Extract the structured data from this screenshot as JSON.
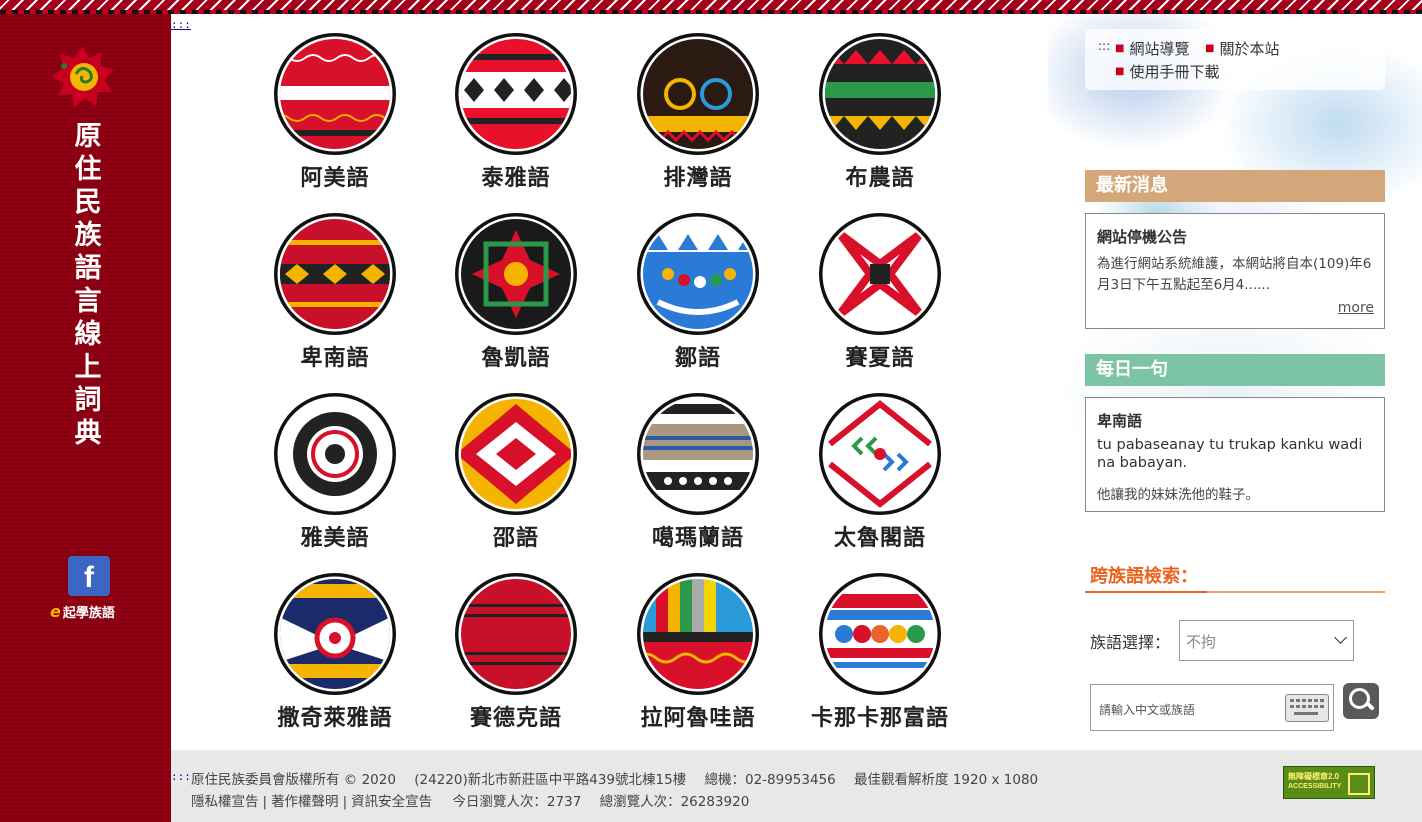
{
  "accesskey": ":::",
  "sidebar": {
    "title": "原住民族語言線上詞典",
    "facebook_icon": "facebook-icon",
    "facebook_glyph": "f",
    "elearning_mark": "e",
    "elearning_label": "起學族語"
  },
  "languages": [
    {
      "label": "阿美語",
      "pattern": "amis"
    },
    {
      "label": "泰雅語",
      "pattern": "atayal"
    },
    {
      "label": "排灣語",
      "pattern": "paiwan"
    },
    {
      "label": "布農語",
      "pattern": "bunun"
    },
    {
      "label": "卑南語",
      "pattern": "puyuma"
    },
    {
      "label": "魯凱語",
      "pattern": "rukai"
    },
    {
      "label": "鄒語",
      "pattern": "tsou"
    },
    {
      "label": "賽夏語",
      "pattern": "saisiyat"
    },
    {
      "label": "雅美語",
      "pattern": "yami"
    },
    {
      "label": "邵語",
      "pattern": "thao"
    },
    {
      "label": "噶瑪蘭語",
      "pattern": "kavalan"
    },
    {
      "label": "太魯閣語",
      "pattern": "truku"
    },
    {
      "label": "撒奇萊雅語",
      "pattern": "sakizaya"
    },
    {
      "label": "賽德克語",
      "pattern": "seediq"
    },
    {
      "label": "拉阿魯哇語",
      "pattern": "hlaalua"
    },
    {
      "label": "卡那卡那富語",
      "pattern": "kanakanavu"
    }
  ],
  "quicklinks": {
    "prefix": ":::",
    "sitemap": "網站導覽",
    "about": "關於本站",
    "manual": "使用手冊下載"
  },
  "news": {
    "heading": "最新消息",
    "heading_color": "#d4a77b",
    "title": "網站停機公告",
    "body": "為進行網站系統維護，本網站將自本(109)年6月3日下午五點起至6月4......",
    "more": "more"
  },
  "daily": {
    "heading": "每日一句",
    "heading_color": "#7dc3a5",
    "language": "卑南語",
    "native": "tu pabaseanay tu trukap kanku wadi na babayan.",
    "chinese": "他讓我的妹妹洗他的鞋子。"
  },
  "search": {
    "title": "跨族語檢索：",
    "lang_label": "族語選擇：",
    "lang_selected": "不拘",
    "placeholder": "請輸入中文或族語",
    "keyboard_icon": "keyboard-icon",
    "search_icon": "search-icon"
  },
  "footer": {
    "copyright": "原住民族委員會版權所有 © 2020",
    "address": "(24220)新北市新莊區中平路439號北棟15樓",
    "phone": "總機：02-89953456",
    "resolution": "最佳觀看解析度 1920 x 1080",
    "privacy": "隱私權宣告",
    "copyright_notice": "著作權聲明",
    "security": "資訊安全宣告",
    "separator": "|",
    "today_visits": "今日瀏覽人次：2737",
    "total_visits": "總瀏覽人次：26283920",
    "badge_line1": "無障礙標章2.0",
    "badge_line2": "ACCESSIBILITY"
  },
  "colors": {
    "sidebar": "#8e0012",
    "accent_orange": "#e8641c",
    "link_dot": "#c8001e"
  }
}
